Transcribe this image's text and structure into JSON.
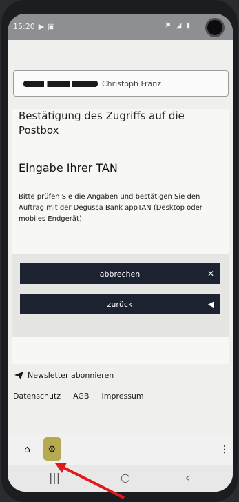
{
  "status_bar": {
    "time": "15:20"
  },
  "user_box": {
    "name": "Christoph Franz"
  },
  "page": {
    "title": "Bestätigung des Zugriffs auf die Postbox",
    "subtitle": "Eingabe Ihrer TAN",
    "instructions": "Bitte prüfen Sie die Angaben und bestätigen Sie den Auftrag mit der Degussa Bank appTAN (Desktop oder mobiles Endgerät)."
  },
  "buttons": {
    "cancel_label": "abbrechen",
    "back_label": "zurück"
  },
  "footer": {
    "newsletter": "Newsletter abonnieren",
    "links": [
      "Datenschutz",
      "AGB",
      "Impressum"
    ]
  },
  "bottom_nav": {
    "icons": [
      "home-icon",
      "gear-icon",
      "more-icon"
    ],
    "highlight_color": "#b7a950"
  },
  "annotation": {
    "arrow_color": "#e01a1a"
  }
}
